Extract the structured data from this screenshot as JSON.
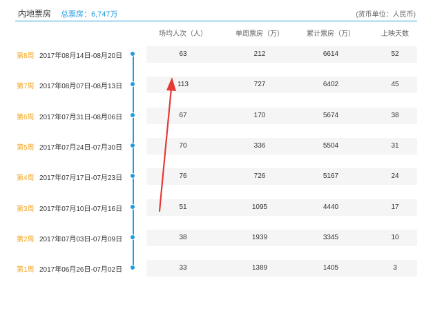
{
  "header": {
    "title": "内地票房",
    "total": "总票房：6,747万",
    "unit": "(货币单位：人民币)"
  },
  "columns": [
    "场均人次（人）",
    "单周票房（万）",
    "累计票房（万）",
    "上映天数"
  ],
  "rows": [
    {
      "week": "第8周",
      "range": "2017年08月14日-08月20日",
      "avg": "63",
      "weekly": "212",
      "cumulative": "6614",
      "days": "52"
    },
    {
      "week": "第7周",
      "range": "2017年08月07日-08月13日",
      "avg": "113",
      "weekly": "727",
      "cumulative": "6402",
      "days": "45"
    },
    {
      "week": "第6周",
      "range": "2017年07月31日-08月06日",
      "avg": "67",
      "weekly": "170",
      "cumulative": "5674",
      "days": "38"
    },
    {
      "week": "第5周",
      "range": "2017年07月24日-07月30日",
      "avg": "70",
      "weekly": "336",
      "cumulative": "5504",
      "days": "31"
    },
    {
      "week": "第4周",
      "range": "2017年07月17日-07月23日",
      "avg": "76",
      "weekly": "726",
      "cumulative": "5167",
      "days": "24"
    },
    {
      "week": "第3周",
      "range": "2017年07月10日-07月16日",
      "avg": "51",
      "weekly": "1095",
      "cumulative": "4440",
      "days": "17"
    },
    {
      "week": "第2周",
      "range": "2017年07月03日-07月09日",
      "avg": "38",
      "weekly": "1939",
      "cumulative": "3345",
      "days": "10"
    },
    {
      "week": "第1周",
      "range": "2017年06月26日-07月02日",
      "avg": "33",
      "weekly": "1389",
      "cumulative": "1405",
      "days": "3"
    }
  ],
  "colors": {
    "accent": "#1e9be0",
    "week_label": "#f5a623",
    "annotation": "#e53935"
  }
}
